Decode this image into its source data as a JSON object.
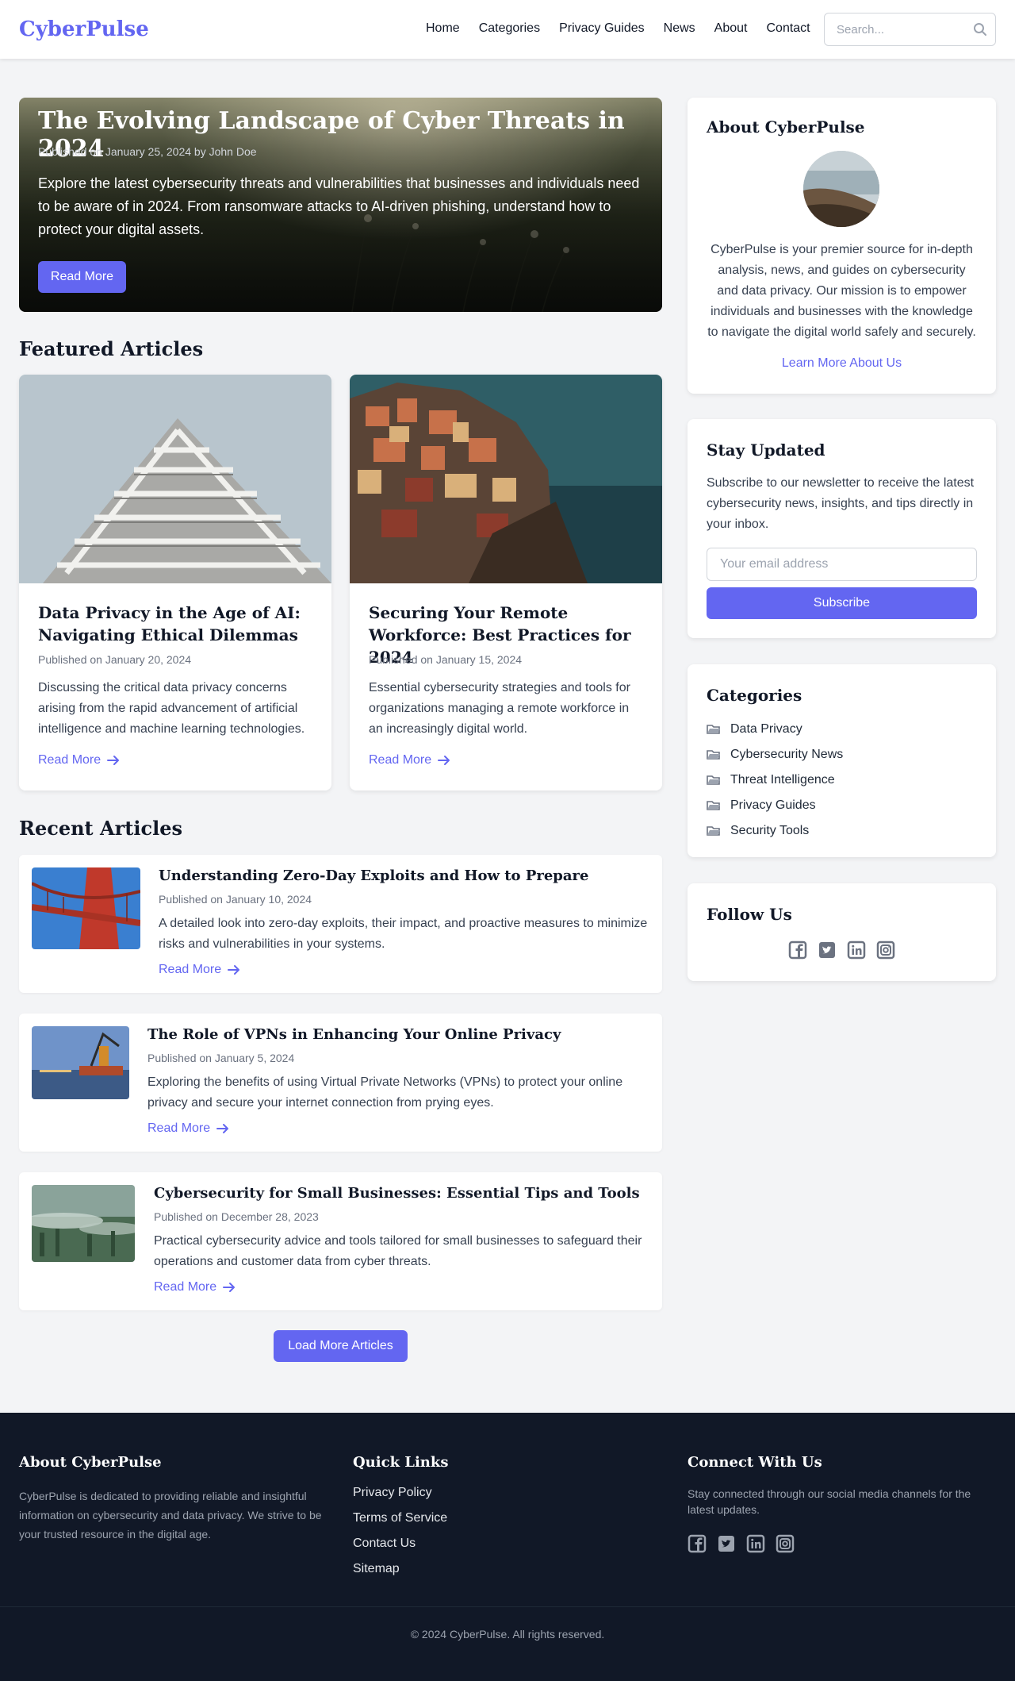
{
  "header": {
    "brand": "CyberPulse",
    "nav": [
      "Home",
      "Categories",
      "Privacy Guides",
      "News",
      "About",
      "Contact"
    ],
    "search_placeholder": "Search..."
  },
  "hero": {
    "title": "The Evolving Landscape of Cyber Threats in 2024",
    "meta": "Published on January 25, 2024 by John Doe",
    "description": "Explore the latest cybersecurity threats and vulnerabilities that businesses and individuals need to be aware of in 2024. From ransomware attacks to AI-driven phishing, understand how to protect your digital assets.",
    "button": "Read More"
  },
  "featured": {
    "heading": "Featured Articles",
    "items": [
      {
        "title": "Data Privacy in the Age of AI: Navigating Ethical Dilemmas",
        "meta": "Published on January 20, 2024",
        "description": "Discussing the critical data privacy concerns arising from the rapid advancement of artificial intelligence and machine learning technologies.",
        "link": "Read More"
      },
      {
        "title": "Securing Your Remote Workforce: Best Practices for 2024",
        "meta": "Published on January 15, 2024",
        "description": "Essential cybersecurity strategies and tools for organizations managing a remote workforce in an increasingly digital world.",
        "link": "Read More"
      }
    ]
  },
  "recent": {
    "heading": "Recent Articles",
    "items": [
      {
        "title": "Understanding Zero-Day Exploits and How to Prepare",
        "meta": "Published on January 10, 2024",
        "description": "A detailed look into zero-day exploits, their impact, and proactive measures to minimize risks and vulnerabilities in your systems.",
        "link": "Read More"
      },
      {
        "title": "The Role of VPNs in Enhancing Your Online Privacy",
        "meta": "Published on January 5, 2024",
        "description": "Exploring the benefits of using Virtual Private Networks (VPNs) to protect your online privacy and secure your internet connection from prying eyes.",
        "link": "Read More"
      },
      {
        "title": "Cybersecurity for Small Businesses: Essential Tips and Tools",
        "meta": "Published on December 28, 2023",
        "description": "Practical cybersecurity advice and tools tailored for small businesses to safeguard their operations and customer data from cyber threats.",
        "link": "Read More"
      }
    ],
    "load_more": "Load More Articles"
  },
  "sidebar": {
    "about": {
      "title": "About CyberPulse",
      "text": "CyberPulse is your premier source for in-depth analysis, news, and guides on cybersecurity and data privacy. Our mission is to empower individuals and businesses with the knowledge to navigate the digital world safely and securely.",
      "link": "Learn More About Us"
    },
    "newsletter": {
      "title": "Stay Updated",
      "text": "Subscribe to our newsletter to receive the latest cybersecurity news, insights, and tips directly in your inbox.",
      "placeholder": "Your email address",
      "button": "Subscribe"
    },
    "categories": {
      "title": "Categories",
      "items": [
        "Data Privacy",
        "Cybersecurity News",
        "Threat Intelligence",
        "Privacy Guides",
        "Security Tools"
      ]
    },
    "follow": {
      "title": "Follow Us",
      "icons": [
        "facebook-icon",
        "twitter-icon",
        "linkedin-icon",
        "instagram-icon"
      ]
    }
  },
  "footer": {
    "about_title": "About CyberPulse",
    "about_text": "CyberPulse is dedicated to providing reliable and insightful information on cybersecurity and data privacy. We strive to be your trusted resource in the digital age.",
    "links_title": "Quick Links",
    "links": [
      "Privacy Policy",
      "Terms of Service",
      "Contact Us",
      "Sitemap"
    ],
    "connect_title": "Connect With Us",
    "connect_text": "Stay connected through our social media channels for the latest updates.",
    "copyright": "© 2024 CyberPulse. All rights reserved."
  },
  "colors": {
    "accent": "#6366f1",
    "footer_bg": "#111827",
    "page_bg": "#f3f4f6"
  }
}
